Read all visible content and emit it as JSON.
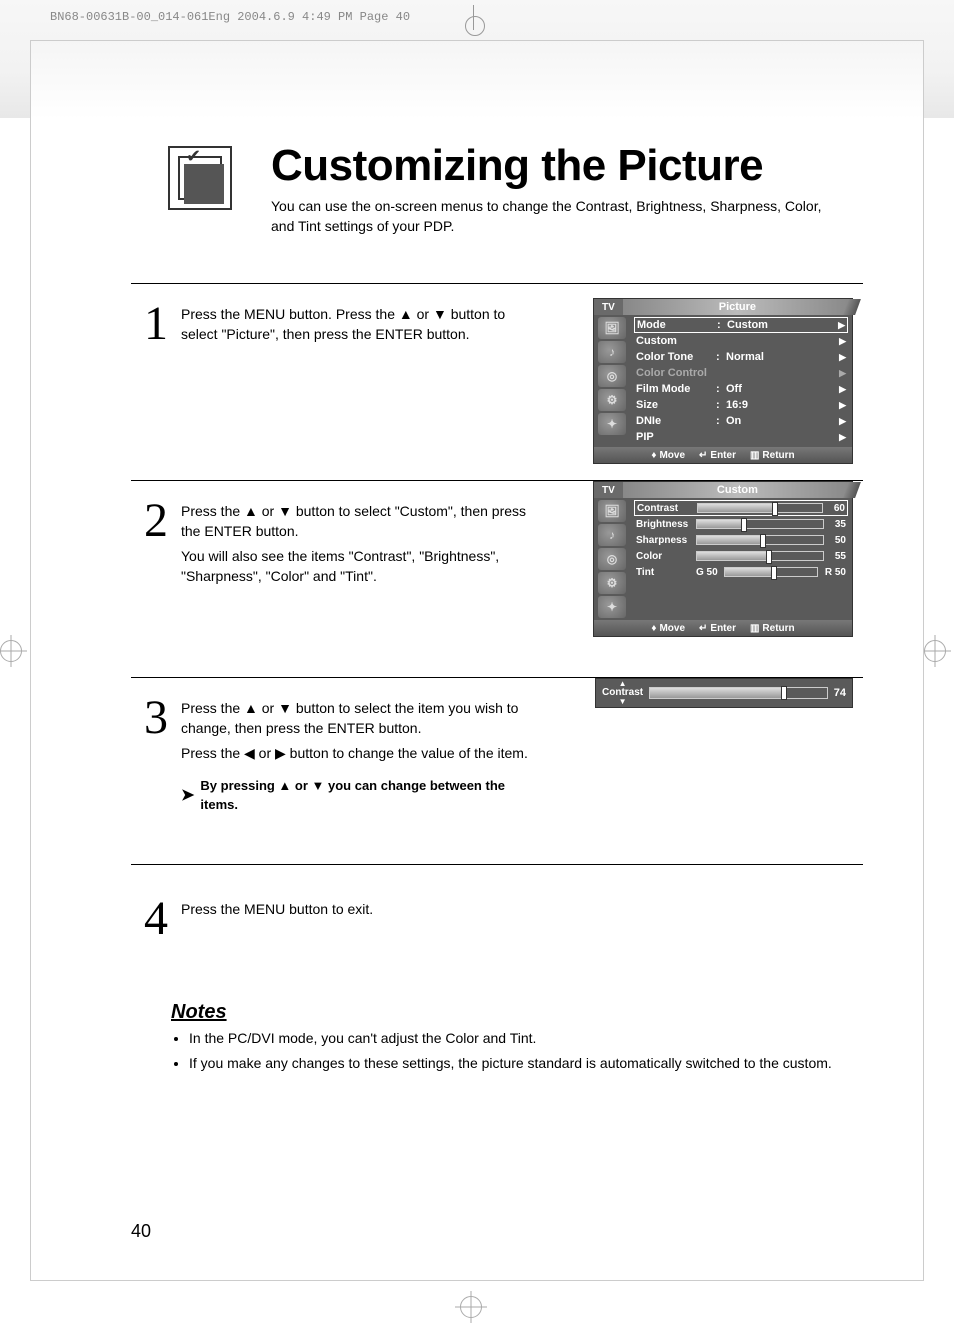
{
  "print_header": "BN68-00631B-00_014-061Eng  2004.6.9  4:49 PM  Page 40",
  "title": "Customizing the Picture",
  "subtitle": "You can use the on-screen menus to change the Contrast, Brightness, Sharpness, Color, and Tint settings of your PDP.",
  "steps": {
    "s1": {
      "num": "1",
      "text": "Press the MENU button. Press the ▲ or ▼ button to select \"Picture\", then press the ENTER button."
    },
    "s2": {
      "num": "2",
      "line1": "Press the ▲ or ▼ button to select \"Custom\", then press the ENTER button.",
      "line2": "You will also see the items \"Contrast\", \"Brightness\", \"Sharpness\", \"Color\" and \"Tint\"."
    },
    "s3": {
      "num": "3",
      "line1": "Press the ▲ or ▼ button to select the item you wish to change, then press the ENTER button.",
      "line2": "Press the ◀ or ▶ button to change the value of the item.",
      "hint": "By pressing ▲ or ▼ you can change between the items."
    },
    "s4": {
      "num": "4",
      "text": "Press the MENU button to exit."
    }
  },
  "osd_picture": {
    "tv": "TV",
    "title": "Picture",
    "rows": [
      {
        "label": "Mode",
        "value": "Custom",
        "selected": true
      },
      {
        "label": "Custom",
        "value": ""
      },
      {
        "label": "Color Tone",
        "value": "Normal"
      },
      {
        "label": "Color Control",
        "value": "",
        "disabled": true
      },
      {
        "label": "Film Mode",
        "value": "Off"
      },
      {
        "label": "Size",
        "value": "16:9"
      },
      {
        "label": "DNIe",
        "value": "On"
      },
      {
        "label": "PIP",
        "value": ""
      }
    ],
    "footer": {
      "move": "Move",
      "enter": "Enter",
      "return": "Return"
    }
  },
  "osd_custom": {
    "tv": "TV",
    "title": "Custom",
    "rows": [
      {
        "label": "Contrast",
        "val": 60,
        "selected": true
      },
      {
        "label": "Brightness",
        "val": 35
      },
      {
        "label": "Sharpness",
        "val": 50
      },
      {
        "label": "Color",
        "val": 55
      },
      {
        "label": "Tint",
        "pre": "G 50",
        "post": "R 50",
        "val": 50
      }
    ],
    "footer": {
      "move": "Move",
      "enter": "Enter",
      "return": "Return"
    }
  },
  "osd_bar": {
    "label": "Contrast",
    "val": 74
  },
  "notes": {
    "heading": "Notes",
    "items": [
      "In the PC/DVI mode, you can't adjust the Color and Tint.",
      "If you make any changes to these settings, the picture standard is automatically switched to the custom."
    ]
  },
  "page_num": "40"
}
